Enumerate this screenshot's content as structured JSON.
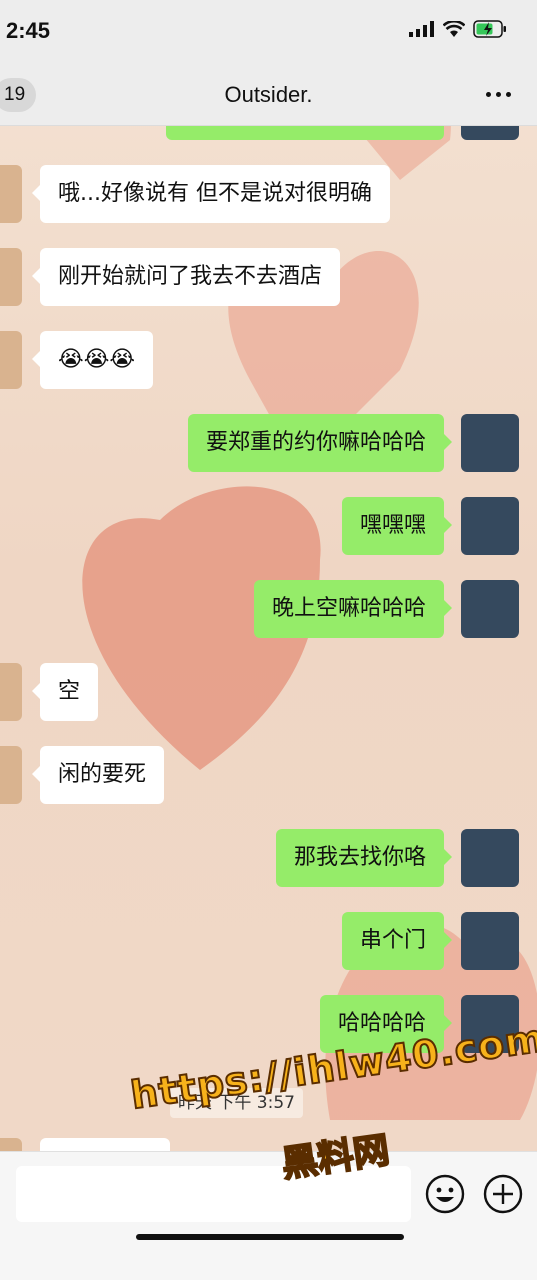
{
  "status_bar": {
    "time": "2:45"
  },
  "nav_bar": {
    "unread_count": "19",
    "title": "Outsider."
  },
  "messages": [
    {
      "side": "in",
      "text": "哦...好像说有 但不是说对很明确"
    },
    {
      "side": "in",
      "text": "刚开始就问了我去不去酒店"
    },
    {
      "side": "in",
      "text": "😭😭😭"
    },
    {
      "side": "out",
      "text": "要郑重的约你嘛哈哈哈"
    },
    {
      "side": "out",
      "text": "嘿嘿嘿"
    },
    {
      "side": "out",
      "text": "晚上空嘛哈哈哈"
    },
    {
      "side": "in",
      "text": "空"
    },
    {
      "side": "in",
      "text": "闲的要死"
    },
    {
      "side": "out",
      "text": "那我去找你咯"
    },
    {
      "side": "out",
      "text": "串个门"
    },
    {
      "side": "out",
      "text": "哈哈哈哈"
    }
  ],
  "timestamp": "昨天 下午 3:57",
  "input_bar": {
    "placeholder": "",
    "value": ""
  },
  "watermark": {
    "url": "https://ihlw40.com",
    "name": "黑料网"
  },
  "colors": {
    "outgoing_bubble": "#95ec69",
    "incoming_bubble": "#ffffff",
    "bar_background": "#ededed",
    "wallpaper_heart": "#e4907a"
  }
}
